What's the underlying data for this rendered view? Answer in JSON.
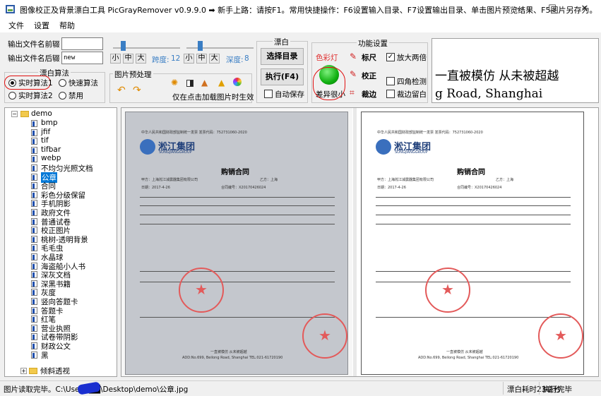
{
  "window": {
    "title": "图像校正及背景漂白工具 PicGrayRemover v0.9.9.0 ➡ 新手上路：请按F1。常用快捷操作：F6设置输入目录、F7设置输出目录、单击图片预览结果、F5图片另存为。",
    "minimize": "—",
    "maximize": "☐",
    "close": "✕"
  },
  "menu": [
    "文件",
    "设置",
    "帮助"
  ],
  "output": {
    "prefix_label": "输出文件名前辍",
    "prefix_value": "",
    "suffix_label": "输出文件名后辍",
    "suffix_value": "new"
  },
  "sliders": {
    "left": {
      "buttons": [
        "小",
        "中",
        "大"
      ],
      "label": "跨度:",
      "value": "12",
      "level_fraction": 0.12
    },
    "right": {
      "buttons": [
        "小",
        "中",
        "大"
      ],
      "label": "深度:",
      "value": "8",
      "level_fraction": 0.18
    }
  },
  "algorithm": {
    "title": "漂白算法",
    "options": [
      {
        "label": "实时算法1",
        "selected": true
      },
      {
        "label": "快速算法",
        "selected": false
      },
      {
        "label": "实时算法2",
        "selected": false
      },
      {
        "label": "禁用",
        "selected": false
      }
    ]
  },
  "preprocess": {
    "title": "图片预处理",
    "note": "仅在点击加载图片时生效",
    "icons": [
      "undo-icon",
      "redo-icon",
      "brightness-icon",
      "contrast-icon",
      "levels-icon",
      "warning-icon",
      "color-palette-icon"
    ]
  },
  "bleach": {
    "title": "漂白",
    "select_dir": "选择目录",
    "execute": "执行(F4)",
    "autosave_label": "自动保存",
    "autosave_checked": false
  },
  "features": {
    "title": "功能设置",
    "color_light_label": "色彩灯",
    "diff_label": "差异很小",
    "light_color": "#10b010",
    "ruler_label": "标尺",
    "correct_label": "校正",
    "crop_label": "裁边",
    "zoom_label": "放大两倍",
    "zoom_checked": true,
    "corner_label": "四角检测",
    "corner_checked": false,
    "crop_white_label": "裁边留白",
    "crop_white_checked": false
  },
  "preview": {
    "line1": "一直被模仿 从未被超越",
    "line2": "g Road, Shanghai"
  },
  "tree": {
    "root": "demo",
    "items": [
      "bmp",
      "jfif",
      "tif",
      "tifbar",
      "webp",
      "不均匀光照文档",
      "公章",
      "合同",
      "彩色分级保留",
      "手机阴影",
      "政府文件",
      "普通试卷",
      "校正图片",
      "桃树-透明背景",
      "毛毛虫",
      "水晶球",
      "海盗船小人书",
      "深灰文档",
      "深黑书籍",
      "灰度",
      "竖向答题卡",
      "答题卡",
      "红笔",
      "营业执照",
      "试卷带阴影",
      "财政公文",
      "黑"
    ],
    "selected": "公章",
    "last_folder": "倾斜透视"
  },
  "document": {
    "stamp_title": "中华人民共和国财政部监制统一发票 发票代码：752731060-2020",
    "company": "淞江集团",
    "company_en": "SONGJIANGGROUP",
    "contract_title": "购销合同",
    "buyer": "甲方：上海淞江减震器集团有限公司",
    "seller": "乙方：上海",
    "date": "日期：2017-4-26",
    "contract_no": "合同编号：X20170426024",
    "footer": "一直被模仿 从未被超越",
    "address": "ADD:No.699, Beilong Road, Shanghai   TEL:021-61720190"
  },
  "status": {
    "left": "图片读取完毕。C:\\Users\\██\\Desktop\\demo\\公章.jpg",
    "time": "漂白耗时23毫秒",
    "done": "执行完毕"
  }
}
